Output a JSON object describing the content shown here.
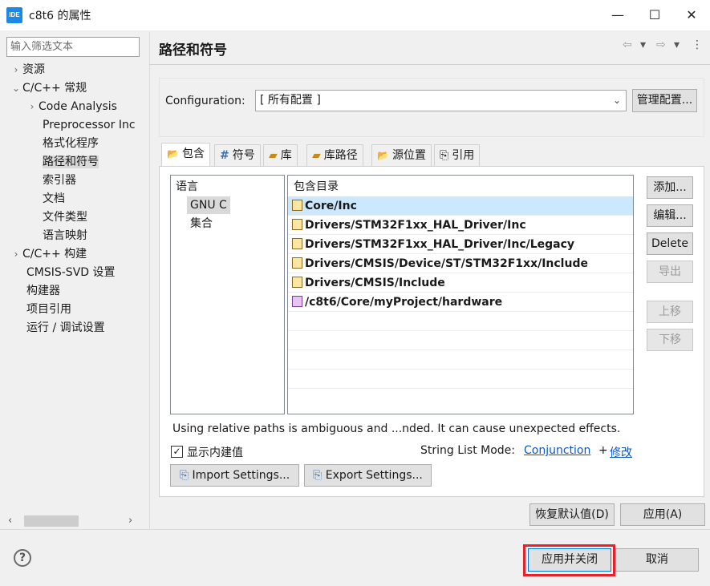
{
  "window": {
    "app_icon_text": "IDE",
    "title": "c8t6 的属性",
    "minimize": "—",
    "maximize": "☐",
    "close": "✕"
  },
  "filter": {
    "placeholder": "输入筛选文本"
  },
  "tree": {
    "items": [
      {
        "label": "资源",
        "chevron": "›"
      },
      {
        "label": "C/C++ 常规",
        "chevron": "⌄"
      },
      {
        "label": "Code Analysis",
        "chevron": "›"
      },
      {
        "label": "Preprocessor Inc",
        "chevron": ""
      },
      {
        "label": "格式化程序",
        "chevron": ""
      },
      {
        "label": "路径和符号",
        "chevron": ""
      },
      {
        "label": "索引器",
        "chevron": ""
      },
      {
        "label": "文档",
        "chevron": ""
      },
      {
        "label": "文件类型",
        "chevron": ""
      },
      {
        "label": "语言映射",
        "chevron": ""
      },
      {
        "label": "C/C++ 构建",
        "chevron": "›"
      },
      {
        "label": "CMSIS-SVD 设置",
        "chevron": ""
      },
      {
        "label": "构建器",
        "chevron": ""
      },
      {
        "label": "项目引用",
        "chevron": ""
      },
      {
        "label": "运行 / 调试设置",
        "chevron": ""
      }
    ],
    "scroll_left": "‹",
    "scroll_right": "›"
  },
  "header": {
    "title": "路径和符号",
    "back": "⇦",
    "back_menu": "▾",
    "forward": "⇨",
    "forward_menu": "▾",
    "more": "⋮"
  },
  "config": {
    "label": "Configuration:",
    "value": "[ 所有配置 ]",
    "arrow": "⌄",
    "manage_label": "管理配置..."
  },
  "tabs": [
    {
      "label": "包含",
      "icon": "📂"
    },
    {
      "label": "符号",
      "icon": "#"
    },
    {
      "label": "库",
      "icon": "▰"
    },
    {
      "label": "库路径",
      "icon": "▰"
    },
    {
      "label": "源位置",
      "icon": "📂"
    },
    {
      "label": "引用",
      "icon": "⎘"
    }
  ],
  "languages": {
    "header": "语言",
    "items": [
      "GNU C",
      "集合"
    ]
  },
  "includes": {
    "header": "包含目录",
    "rows": [
      "Core/Inc",
      "Drivers/STM32F1xx_HAL_Driver/Inc",
      "Drivers/STM32F1xx_HAL_Driver/Inc/Legacy",
      "Drivers/CMSIS/Device/ST/STM32F1xx/Include",
      "Drivers/CMSIS/Include",
      "/c8t6/Core/myProject/hardware"
    ]
  },
  "side_buttons": {
    "add": "添加...",
    "edit": "编辑...",
    "delete": "Delete",
    "export": "导出",
    "move_up": "上移",
    "move_down": "下移"
  },
  "warning": "Using relative paths is ambiguous and ...nded. It can cause unexpected effects.",
  "builtin": {
    "checkmark": "✓",
    "label": "显示内建值"
  },
  "string_list_mode": {
    "label": "String List Mode:",
    "value": "Conjunction",
    "plus": "+",
    "edit": "修改"
  },
  "settings": {
    "import_label": "Import Settings...",
    "export_label": "Export Settings..."
  },
  "footer": {
    "restore_label": "恢复默认值(D)",
    "apply_label": "应用(A)",
    "help": "?",
    "apply_close_label": "应用并关闭",
    "cancel_label": "取消"
  },
  "colors": {
    "highlight_border": "#e8202a",
    "link": "#0b57c8",
    "selection": "#cce8ff"
  }
}
